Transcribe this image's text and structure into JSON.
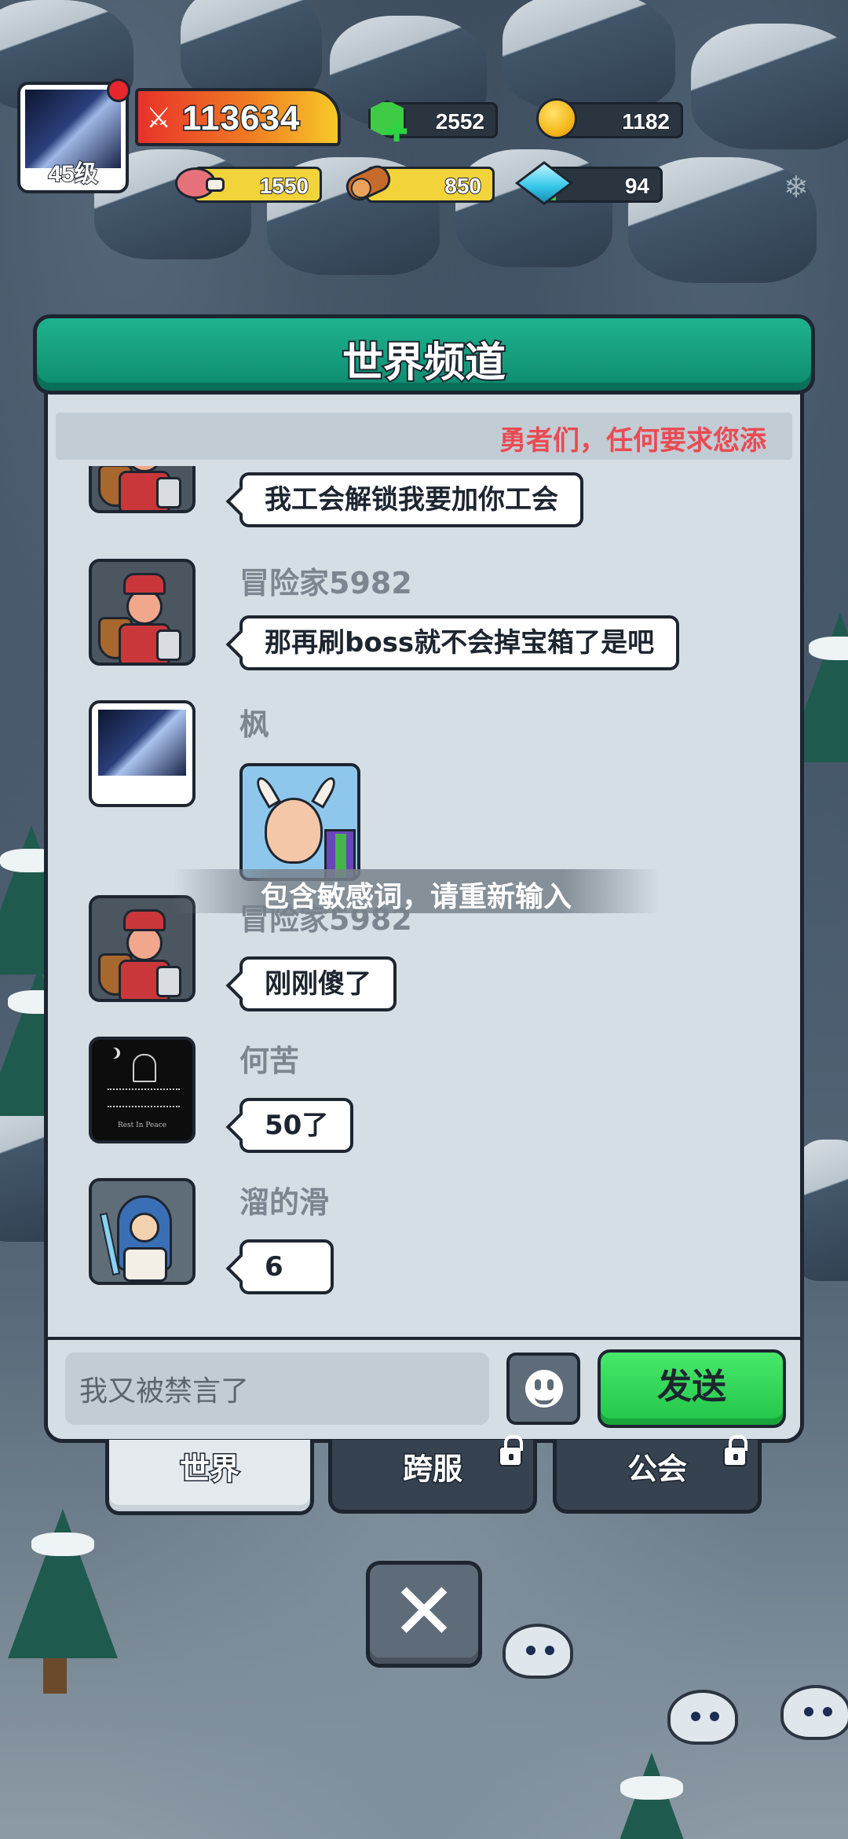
{
  "player": {
    "level_label": "45级",
    "power": "113634"
  },
  "resources": {
    "gems": "2552",
    "gold": "1182",
    "meat": "1550",
    "wood": "850",
    "crystal": "94",
    "crystal_fill_fraction": 0.1
  },
  "chat": {
    "title": "世界频道",
    "notice": "勇者们，任何要求您添",
    "messages": [
      {
        "name": "",
        "text": "我工会解锁我要加你工会",
        "avatar": "warrior"
      },
      {
        "name": "冒险家5982",
        "text": "那再刷boss就不会掉宝箱了是吧",
        "avatar": "warrior"
      },
      {
        "name": "枫",
        "text": "",
        "avatar": "anime",
        "sticker": true
      },
      {
        "name": "冒险家5982",
        "text": "刚刚傻了",
        "avatar": "warrior"
      },
      {
        "name": "何苦",
        "text": "50了",
        "avatar": "grave",
        "avatar_caption": "Rest In Peace"
      },
      {
        "name": "溜的滑",
        "text": "6",
        "avatar": "priest"
      }
    ],
    "toast": "包含敏感词，请重新输入",
    "input_value": "我又被禁言了",
    "send_label": "发送"
  },
  "tabs": [
    {
      "label": "世界",
      "locked": false,
      "active": true
    },
    {
      "label": "跨服",
      "locked": true,
      "active": false
    },
    {
      "label": "公会",
      "locked": true,
      "active": false
    }
  ],
  "icons": {
    "close": "close-icon",
    "emoji": "emoji-icon",
    "lock": "lock-icon",
    "power": "crossed-swords-icon",
    "gems": "green-gem-icon",
    "gold": "gold-coin-icon",
    "meat": "meat-icon",
    "wood": "wood-log-icon",
    "crystal": "crystal-icon"
  },
  "colors": {
    "header_green": "#0d8a6e",
    "send_green": "#22c549",
    "notice_red": "#ea4b52",
    "panel_bg": "#d5dde5"
  }
}
